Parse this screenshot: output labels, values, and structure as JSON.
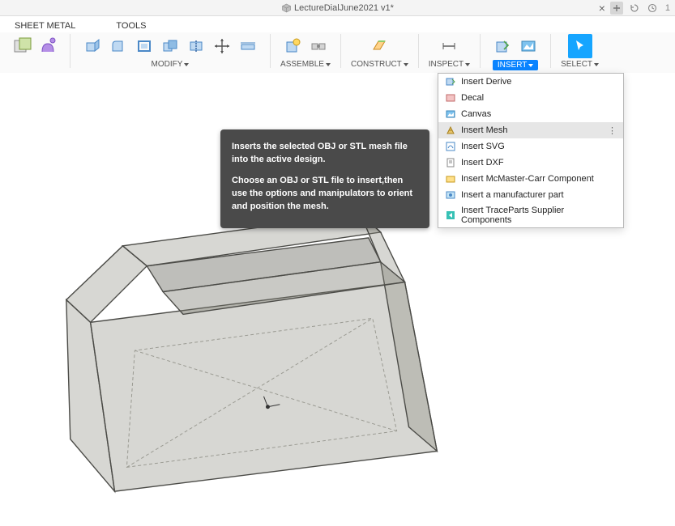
{
  "titlebar": {
    "document_title": "LectureDialJune2021 v1*",
    "close_glyph": "×"
  },
  "menu": {
    "sheet_metal": "SHEET METAL",
    "tools": "TOOLS"
  },
  "toolbar": {
    "modify_label": "MODIFY",
    "assemble_label": "ASSEMBLE",
    "construct_label": "CONSTRUCT",
    "inspect_label": "INSPECT",
    "insert_label": "INSERT",
    "select_label": "SELECT"
  },
  "dropdown": {
    "items": [
      "Insert Derive",
      "Decal",
      "Canvas",
      "Insert Mesh",
      "Insert SVG",
      "Insert DXF",
      "Insert McMaster-Carr Component",
      "Insert a manufacturer part",
      "Insert TraceParts Supplier Components"
    ],
    "selected_index": 3
  },
  "tooltip": {
    "line1": "Inserts the selected OBJ or STL mesh file into the active design.",
    "line2": "Choose an OBJ or STL file to insert,then use the options and manipulators to orient and position the mesh."
  }
}
